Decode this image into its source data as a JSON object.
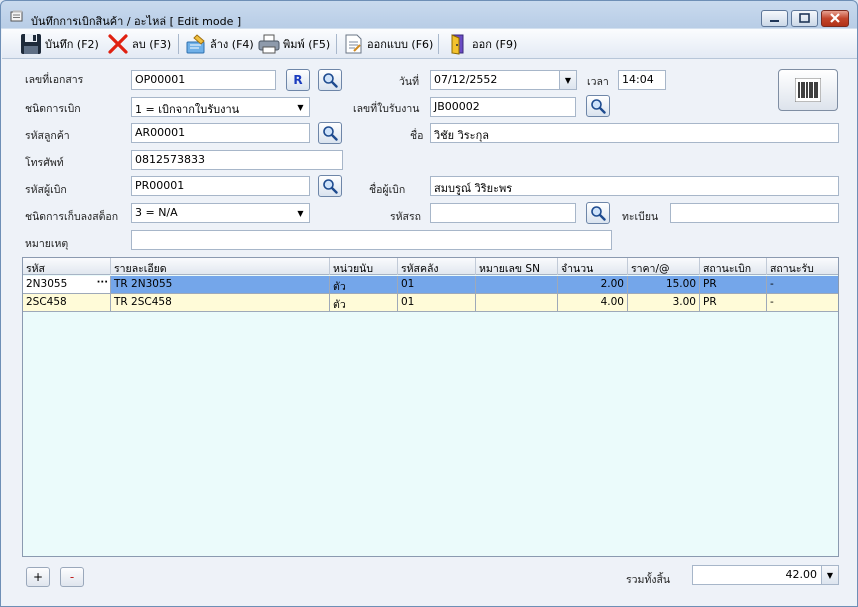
{
  "window": {
    "title": "บันทึกการเบิกสินค้า / อะไหล่ [ Edit mode ]"
  },
  "toolbar": {
    "save": "บันทึก (F2)",
    "delete": "ลบ (F3)",
    "clear": "ล้าง (F4)",
    "print": "พิมพ์ (F5)",
    "design": "ออกแบบ (F6)",
    "exit": "ออก (F9)"
  },
  "form": {
    "doc_no_label": "เลขที่เอกสาร",
    "doc_no": "OP00001",
    "r_button": "R",
    "date_label": "วันที่",
    "date": "07/12/2552",
    "time_label": "เวลา",
    "time": "14:04",
    "issue_type_label": "ชนิดการเบิก",
    "issue_type": "1 = เบิกจากใบรับงาน",
    "job_no_label": "เลขที่ใบรับงาน",
    "job_no": "JB00002",
    "customer_code_label": "รหัสลูกค้า",
    "customer_code": "AR00001",
    "name_label": "ชื่อ",
    "name": "วิชัย  วิระกุล",
    "phone_label": "โทรศัพท์",
    "phone": "0812573833",
    "requester_code_label": "รหัสผู้เบิก",
    "requester_code": "PR00001",
    "requester_name_label": "ชื่อผู้เบิก",
    "requester_name": "สมบรูณ์  วิริยะพร",
    "stock_type_label": "ชนิดการเก็บลงสต็อก",
    "stock_type": "3 = N/A",
    "car_code_label": "รหัสรถ",
    "car_code": "",
    "plate_label": "ทะเบียน",
    "plate": "",
    "remark_label": "หมายเหตุ",
    "remark": ""
  },
  "grid": {
    "headers": [
      "รหัส",
      "รายละเอียด",
      "หน่วยนับ",
      "รหัสคลัง",
      "หมายเลข SN",
      "จำนวน",
      "ราคา/@",
      "สถานะเบิก",
      "สถานะรับ"
    ],
    "rows": [
      [
        "2N3055",
        "TR 2N3055",
        "ตัว",
        "01",
        "",
        "2.00",
        "15.00",
        "PR",
        "-"
      ],
      [
        "2SC458",
        "TR 2SC458",
        "ตัว",
        "01",
        "",
        "4.00",
        "3.00",
        "PR",
        "-"
      ]
    ]
  },
  "footer": {
    "add": "+",
    "remove": "-",
    "total_label": "รวมทั้งสิ้น",
    "total": "42.00"
  },
  "colors": {
    "selected_row": "#74a6ea",
    "normal_row": "#fffbd8",
    "grid_bg": "#ebfbfb"
  }
}
